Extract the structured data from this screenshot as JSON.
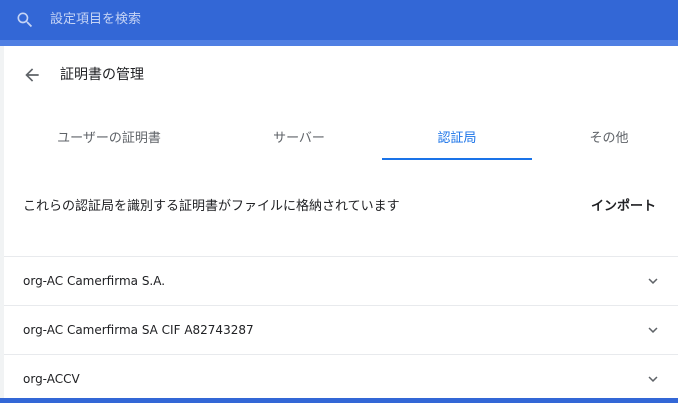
{
  "search": {
    "placeholder": "設定項目を検索"
  },
  "header": {
    "title": "証明書の管理"
  },
  "tabs": [
    {
      "label": "ユーザーの証明書"
    },
    {
      "label": "サーバー"
    },
    {
      "label": "認証局"
    },
    {
      "label": "その他"
    }
  ],
  "active_tab": "認証局",
  "main": {
    "description": "これらの認証局を識別する証明書がファイルに格納されています",
    "import_label": "インポート"
  },
  "authorities": [
    {
      "name": "org-AC Camerfirma S.A."
    },
    {
      "name": "org-AC Camerfirma SA CIF A82743287"
    },
    {
      "name": "org-ACCV"
    }
  ],
  "colors": {
    "header": "#3367d6",
    "accent": "#1a73e8",
    "text": "#202124",
    "muted": "#5f6368",
    "divider": "#e8eaed"
  },
  "icons": {
    "search": "search-icon",
    "back": "arrow-back-icon",
    "expand": "chevron-down-icon"
  }
}
